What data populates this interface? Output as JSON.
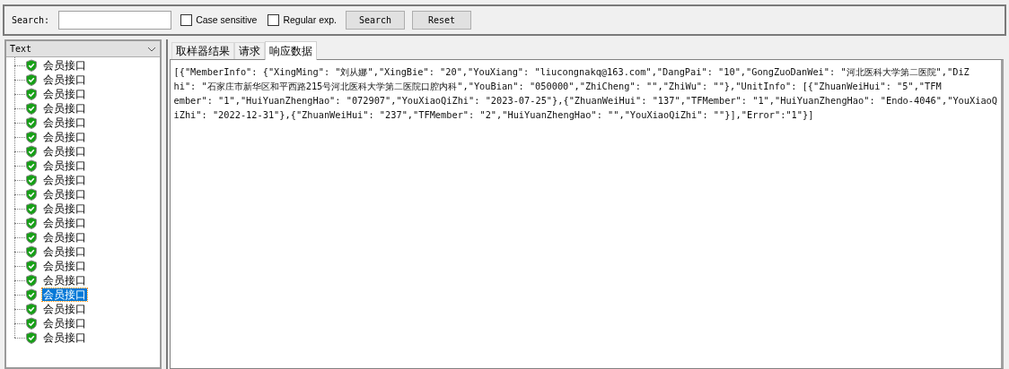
{
  "search_bar": {
    "label": "Search:",
    "options": [
      {
        "label": "Case sensitive",
        "checked": false
      },
      {
        "label": "Regular exp.",
        "checked": false
      }
    ],
    "buttons": [
      "Search",
      "Reset"
    ]
  },
  "renderer": {
    "value": "Text"
  },
  "tree": {
    "items": [
      {
        "label": "会员接口",
        "kind": "success",
        "selected": false
      },
      {
        "label": "会员接口",
        "kind": "success",
        "selected": false
      },
      {
        "label": "会员接口",
        "kind": "success",
        "selected": false
      },
      {
        "label": "会员接口",
        "kind": "success",
        "selected": false
      },
      {
        "label": "会员接口",
        "kind": "success",
        "selected": false
      },
      {
        "label": "会员接口",
        "kind": "success",
        "selected": false
      },
      {
        "label": "会员接口",
        "kind": "success",
        "selected": false
      },
      {
        "label": "会员接口",
        "kind": "success",
        "selected": false
      },
      {
        "label": "会员接口",
        "kind": "success",
        "selected": false
      },
      {
        "label": "会员接口",
        "kind": "success",
        "selected": false
      },
      {
        "label": "会员接口",
        "kind": "success",
        "selected": false
      },
      {
        "label": "会员接口",
        "kind": "success",
        "selected": false
      },
      {
        "label": "会员接口",
        "kind": "success",
        "selected": false
      },
      {
        "label": "会员接口",
        "kind": "success",
        "selected": false
      },
      {
        "label": "会员接口",
        "kind": "success",
        "selected": false
      },
      {
        "label": "会员接口",
        "kind": "success",
        "selected": false
      },
      {
        "label": "会员接口",
        "kind": "success",
        "selected": true
      },
      {
        "label": "会员接口",
        "kind": "success",
        "selected": false
      },
      {
        "label": "会员接口",
        "kind": "success",
        "selected": false
      },
      {
        "label": "会员接口",
        "kind": "success",
        "selected": false
      }
    ]
  },
  "tabs": [
    {
      "label": "取样器结果",
      "selected": false
    },
    {
      "label": "请求",
      "selected": false
    },
    {
      "label": "响应数据",
      "selected": true
    }
  ],
  "response_lines": [
    "[{\"MemberInfo\": {\"XingMing\": \"刘从娜\",\"XingBie\": \"20\",\"YouXiang\": \"liucongnakq@163.com\",\"DangPai\": \"10\",\"GongZuoDanWei\": \"河北医科大学第二医院\",\"DiZ",
    "hi\": \"石家庄市新华区和平西路215号河北医科大学第二医院口腔内科\",\"YouBian\": \"050000\",\"ZhiCheng\": \"\",\"ZhiWu\": \"\"},\"UnitInfo\": [{\"ZhuanWeiHui\": \"5\",\"TFM",
    "ember\": \"1\",\"HuiYuanZhengHao\": \"072907\",\"YouXiaoQiZhi\": \"2023-07-25\"},{\"ZhuanWeiHui\": \"137\",\"TFMember\": \"1\",\"HuiYuanZhengHao\": \"Endo-4046\",\"YouXiaoQ",
    "iZhi\": \"2022-12-31\"},{\"ZhuanWeiHui\": \"237\",\"TFMember\": \"2\",\"HuiYuanZhengHao\": \"\",\"YouXiaoQiZhi\": \"\"}],\"Error\":\"1\"}]"
  ]
}
